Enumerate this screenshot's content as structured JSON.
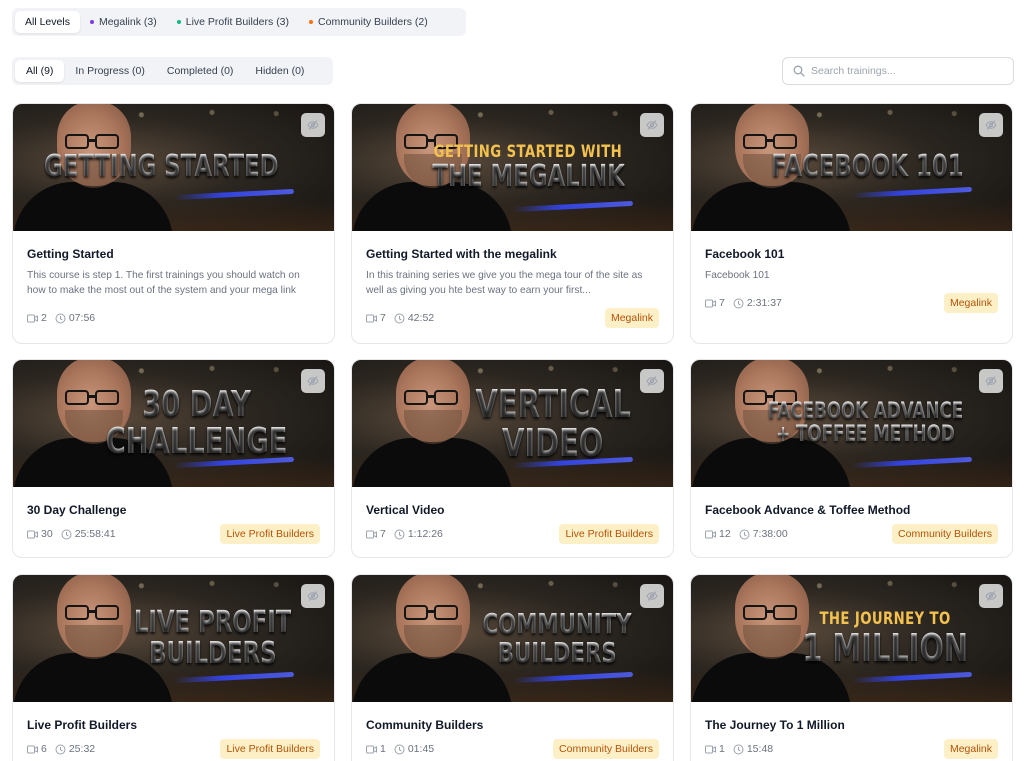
{
  "level_filters": [
    {
      "label": "All Levels",
      "dot": ""
    },
    {
      "label": "Megalink (3)",
      "dot": "#7c3aed"
    },
    {
      "label": "Live Profit Builders (3)",
      "dot": "#10b981"
    },
    {
      "label": "Community Builders (2)",
      "dot": "#f97316"
    }
  ],
  "status_filters": [
    {
      "label": "All (9)"
    },
    {
      "label": "In Progress (0)"
    },
    {
      "label": "Completed (0)"
    },
    {
      "label": "Hidden (0)"
    }
  ],
  "search": {
    "placeholder": "Search trainings..."
  },
  "colors": {
    "badge_bg": "#fdf0c6",
    "badge_text": "#b45309"
  },
  "cards": [
    {
      "thumb_small": "",
      "thumb_big": "GETTING STARTED",
      "title": "Getting Started",
      "desc": "This course is step 1. The first trainings you should watch on how to make the most out of the system and your mega link",
      "videos": "2",
      "duration": "07:56",
      "badge": ""
    },
    {
      "thumb_small": "GETTING STARTED WITH",
      "thumb_big": "THE MEGALINK",
      "title": "Getting Started with the megalink",
      "desc": "In this training series we give you the mega tour of the site as well as giving you hte best way to earn your first...",
      "videos": "7",
      "duration": "42:52",
      "badge": "Megalink"
    },
    {
      "thumb_small": "",
      "thumb_big": "FACEBOOK 101",
      "title": "Facebook 101",
      "desc": "Facebook 101",
      "videos": "7",
      "duration": "2:31:37",
      "badge": "Megalink"
    },
    {
      "thumb_small": "",
      "thumb_big": "30 DAY CHALLENGE",
      "title": "30 Day Challenge",
      "desc": "",
      "videos": "30",
      "duration": "25:58:41",
      "badge": "Live Profit Builders"
    },
    {
      "thumb_small": "",
      "thumb_big": "VERTICAL VIDEO",
      "title": "Vertical Video",
      "desc": "",
      "videos": "7",
      "duration": "1:12:26",
      "badge": "Live Profit Builders"
    },
    {
      "thumb_small": "",
      "thumb_big": "FACEBOOK ADVANCE + TOFFEE METHOD",
      "title": "Facebook Advance & Toffee Method",
      "desc": "",
      "videos": "12",
      "duration": "7:38:00",
      "badge": "Community Builders"
    },
    {
      "thumb_small": "",
      "thumb_big": "LIVE PROFIT BUILDERS",
      "title": "Live Profit Builders",
      "desc": "",
      "videos": "6",
      "duration": "25:32",
      "badge": "Live Profit Builders"
    },
    {
      "thumb_small": "",
      "thumb_big": "COMMUNITY BUILDERS",
      "title": "Community Builders",
      "desc": "",
      "videos": "1",
      "duration": "01:45",
      "badge": "Community Builders"
    },
    {
      "thumb_small": "THE JOURNEY TO",
      "thumb_big": "1 MILLION",
      "title": "The Journey To 1 Million",
      "desc": "",
      "videos": "1",
      "duration": "15:48",
      "badge": "Megalink"
    }
  ]
}
